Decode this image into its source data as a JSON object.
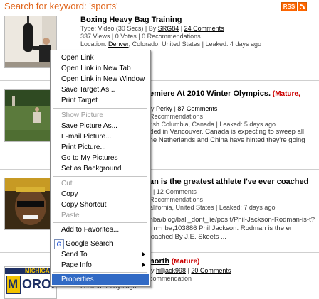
{
  "header": {
    "title": "Search for keyword: 'sports'",
    "rss_label": "RSS"
  },
  "results": [
    {
      "title": "Boxing Heavy Bag Training",
      "meta1_prefix": "Type: Video (30 Secs) | By ",
      "user": "SRG84",
      "comments": "24 Comments",
      "meta2": "337 Views | 0 Votes | 0 Recommendations",
      "meta3_prefix": "Location: ",
      "location_link": "Denver",
      "meta3_suffix": ", Colorado, United States | Leaked: 4 days ago"
    },
    {
      "title": "emiere At 2010 Winter Olympics.",
      "mature": "(Mature,",
      "meta1_prefix": "By ",
      "user": "Perky",
      "comments": "87 Comments",
      "meta2": "Recommendations",
      "meta3": "tish Columbia, Canada | Leaked: 5 days ago",
      "snippet": "rded in Vancouver. Canada is expecting to sweep all the Netherlands and China have hinted they're going"
    },
    {
      "title": "an is the greatest athlete I've ever coached",
      "meta1": "ı | 12 Comments",
      "meta2": "Recommendations",
      "meta3": "alifornia, United States | Leaked: 7 days ago",
      "snippet": "/nba/blog/ball_dont_lie/pos t/Phil-Jackson-Rodman-is-t?urn=nba,103886 Phil Jackson: Rodman is the er coached By J.E. Skeets ..."
    },
    {
      "title": "north",
      "mature": "(Mature)",
      "meta1_prefix": "By ",
      "user": "hilljack998",
      "comments": "20 Comments",
      "meta2": "commendation",
      "meta3": "Leaked: 7 days ago"
    }
  ],
  "thumb_text": {
    "michigan": "MICHIGA",
    "morons": "ORONS"
  },
  "context_menu": {
    "group1": [
      "Open Link",
      "Open Link in New Tab",
      "Open Link in New Window",
      "Save Target As...",
      "Print Target"
    ],
    "group2": [
      "Show Picture",
      "Save Picture As...",
      "E-mail Picture...",
      "Print Picture...",
      "Go to My Pictures",
      "Set as Background"
    ],
    "group3": [
      "Cut",
      "Copy",
      "Copy Shortcut",
      "Paste"
    ],
    "group4": [
      "Add to Favorites..."
    ],
    "google": "Google Search",
    "send_to": "Send To",
    "page_info": "Page Info",
    "properties": "Properties"
  },
  "colors": {
    "title_orange": "#e0641a",
    "highlight": "#316ac5",
    "rss": "#ff6600",
    "mature_red": "#cc0000"
  },
  "icons": [
    "rss-icon",
    "feed-icon",
    "google-icon",
    "submenu-arrow-icon"
  ]
}
